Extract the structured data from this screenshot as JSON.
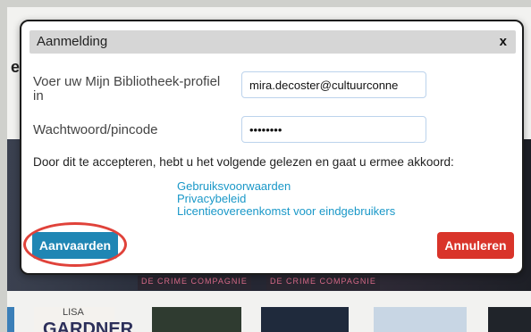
{
  "background": {
    "cutoff_text": "e",
    "cover_strip_1": "DE CRIME COMPAGNIE",
    "cover_strip_2": "DE CRIME COMPAGNIE",
    "book_author_first": "LISA",
    "book_author_last": "GARDNER"
  },
  "dialog": {
    "title": "Aanmelding",
    "close_label": "x",
    "profile_label": "Voer uw Mijn Bibliotheek-profiel in",
    "profile_value": "mira.decoster@cultuurconne",
    "password_label": "Wachtwoord/pincode",
    "password_value": "pincode1",
    "agree_text": "Door dit te accepteren, hebt u het volgende gelezen en gaat u ermee akkoord:",
    "links": [
      "Gebruiksvoorwaarden",
      "Privacybeleid",
      "Licentieovereenkomst voor eindgebruikers"
    ],
    "accept_label": "Aanvaarden",
    "cancel_label": "Annuleren"
  },
  "colors": {
    "link": "#1a98c8",
    "accept": "#1f86b4",
    "cancel": "#d9342a",
    "highlight_ring": "#e0423a"
  }
}
